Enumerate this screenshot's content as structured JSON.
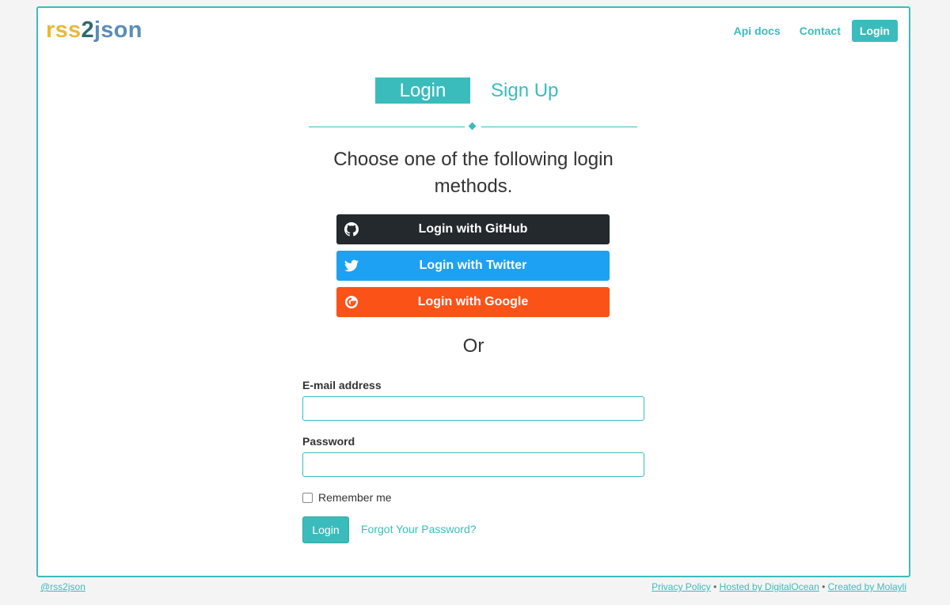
{
  "header": {
    "logo_part1": "rss",
    "logo_part2": "2",
    "logo_part3": "json",
    "nav": {
      "api_docs": "Api docs",
      "contact": "Contact",
      "login": "Login"
    }
  },
  "tabs": {
    "login": "Login",
    "signup": "Sign Up"
  },
  "intro": {
    "heading": "Choose one of the following login methods."
  },
  "social": {
    "github": {
      "label": "Login with GitHub",
      "icon": "github-icon",
      "color": "#24292e"
    },
    "twitter": {
      "label": "Login with Twitter",
      "icon": "twitter-icon",
      "color": "#1da1f2"
    },
    "google": {
      "label": "Login with Google",
      "icon": "google-icon",
      "color": "#fb5218"
    }
  },
  "or_text": "Or",
  "form": {
    "email_label": "E-mail address",
    "email_value": "",
    "password_label": "Password",
    "password_value": "",
    "remember_label": "Remember me",
    "remember_checked": false,
    "submit_label": "Login",
    "forgot_label": "Forgot Your Password?"
  },
  "footer": {
    "handle": "@rss2json",
    "privacy": "Privacy Policy",
    "hosted": "Hosted by DigitalOcean",
    "created": "Created by Molayli",
    "separator": " • "
  },
  "colors": {
    "accent": "#3bbcbc",
    "logo_yellow": "#e8b93a",
    "logo_dark": "#2c6a6e",
    "logo_blue": "#5a8db8"
  }
}
